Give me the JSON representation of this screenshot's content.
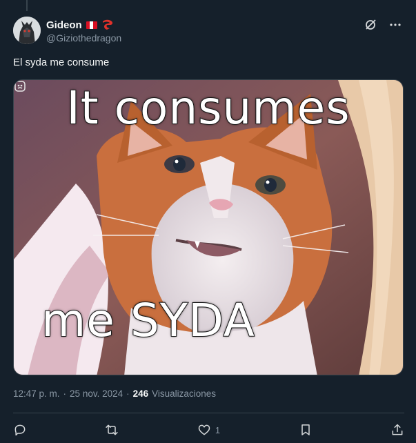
{
  "author": {
    "display_name": "Gideon",
    "handle": "@Giziothedragon",
    "flag": "peru-flag-icon",
    "badge": "red-dragon-icon"
  },
  "tweet": {
    "text": "El syda me consume"
  },
  "media": {
    "caption_top": "It consumes",
    "caption_bottom": "me SYDA",
    "badge": "content-warning-icon"
  },
  "meta": {
    "time": "12:47 p. m.",
    "separator": "·",
    "date": "25 nov. 2024",
    "separator2": "·",
    "views_count": "246",
    "views_label": "Visualizaciones"
  },
  "actions": {
    "reply": "reply-icon",
    "retweet": "retweet-icon",
    "like": "heart-icon",
    "like_count": "1",
    "bookmark": "bookmark-icon",
    "share": "share-icon"
  },
  "colors": {
    "background": "#15202b",
    "text_primary": "#f7f9f9",
    "text_secondary": "#8b98a5",
    "border": "#38444d"
  }
}
